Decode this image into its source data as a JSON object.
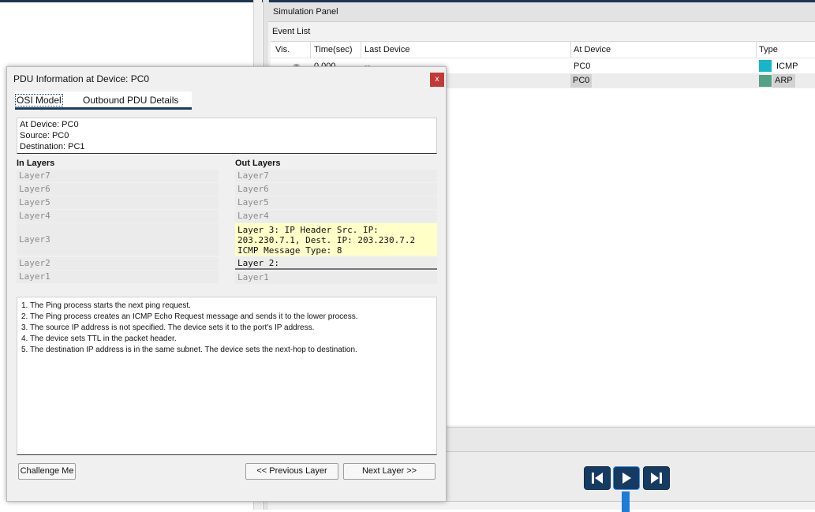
{
  "sim_panel": {
    "title": "Simulation Panel",
    "event_list_label": "Event List",
    "columns": [
      "Vis.",
      "Time(sec)",
      "Last Device",
      "At Device",
      "Type"
    ],
    "events": [
      {
        "time": "0.000",
        "last_device": "--",
        "at_device": "PC0",
        "type": "ICMP",
        "color": "#17b6c6"
      },
      {
        "time": "",
        "last_device": "",
        "at_device": "PC0",
        "type": "ARP",
        "color": "#55a088"
      }
    ],
    "controls": [
      "skip-back-icon",
      "play-icon",
      "skip-forward-icon"
    ],
    "accent": "#163b63"
  },
  "dialog": {
    "title": "PDU Information at Device: PC0",
    "close": "x",
    "tabs": [
      "OSI Model",
      "Outbound PDU Details"
    ],
    "info": {
      "at_device": "At Device: PC0",
      "source": "Source: PC0",
      "destination": "Destination: PC1"
    },
    "in_layers_label": "In Layers",
    "out_layers_label": "Out Layers",
    "in_layers": [
      "Layer7",
      "Layer6",
      "Layer5",
      "Layer4",
      "Layer3",
      "Layer2",
      "Layer1"
    ],
    "out_layers": [
      "Layer7",
      "Layer6",
      "Layer5",
      "Layer4",
      "Layer 3: IP Header Src. IP: 203.230.7.1, Dest. IP: 203.230.7.2 ICMP Message Type: 8",
      "Layer 2:",
      "Layer1"
    ],
    "description": [
      "1. The Ping process starts the next ping request.",
      "2. The Ping process creates an ICMP Echo Request message and sends it to the lower process.",
      "3. The source IP address is not specified. The device sets it to the port's IP address.",
      "4. The device sets TTL in the packet header.",
      "5. The destination IP address is in the same subnet. The device sets the next-hop to destination."
    ],
    "buttons": {
      "challenge": "Challenge Me",
      "prev": "<< Previous Layer",
      "next": "Next Layer >>"
    },
    "highlight_color": "#ffffc8"
  }
}
